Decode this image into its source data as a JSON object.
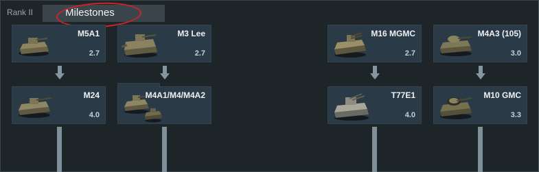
{
  "header": {
    "rank_label": "Rank II",
    "tab_label": "Milestones"
  },
  "vehicles": {
    "m5a1": {
      "name": "M5A1",
      "br": "2.7"
    },
    "m3lee": {
      "name": "M3 Lee",
      "br": "2.7"
    },
    "m16": {
      "name": "M16 MGMC",
      "br": "2.7"
    },
    "m4a3": {
      "name": "M4A3 (105)",
      "br": "3.0"
    },
    "m24": {
      "name": "M24",
      "br": "4.0"
    },
    "m4a1": {
      "name": "M4A1/M4/M4A2",
      "br": ""
    },
    "t77e1": {
      "name": "T77E1",
      "br": "4.0"
    },
    "m10": {
      "name": "M10 GMC",
      "br": "3.3"
    }
  },
  "colors": {
    "background": "#1e2529",
    "card": "#2a3a46",
    "connector": "#7e8f99",
    "annotation": "#d3202a"
  }
}
